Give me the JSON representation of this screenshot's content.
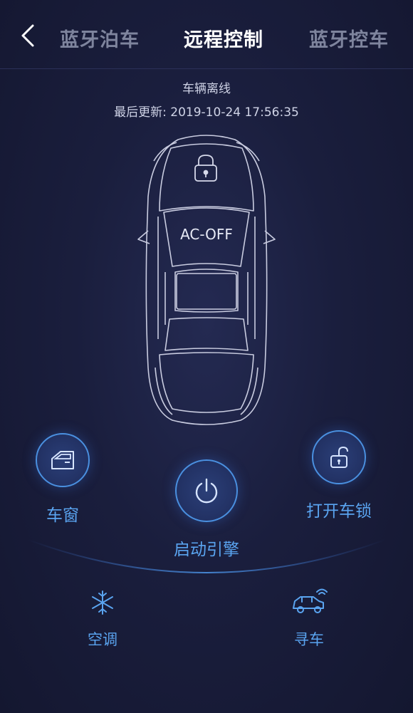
{
  "header": {
    "tabs": [
      {
        "label": "蓝牙泊车",
        "active": false
      },
      {
        "label": "远程控制",
        "active": true
      },
      {
        "label": "蓝牙控车",
        "active": false
      }
    ]
  },
  "vehicle": {
    "status": "车辆离线",
    "last_updated": "最后更新: 2019-10-24 17:56:35",
    "ac_status": "AC-OFF",
    "lock_icon": "locked-padlock-icon"
  },
  "controls": {
    "window_label": "车窗",
    "engine_label": "启动引擎",
    "unlock_label": "打开车锁"
  },
  "bottom": {
    "ac_label": "空调",
    "find_car_label": "寻车"
  },
  "colors": {
    "accent": "#4a90e0",
    "label_blue": "#5aa4f0",
    "background": "#1a1e3d"
  }
}
